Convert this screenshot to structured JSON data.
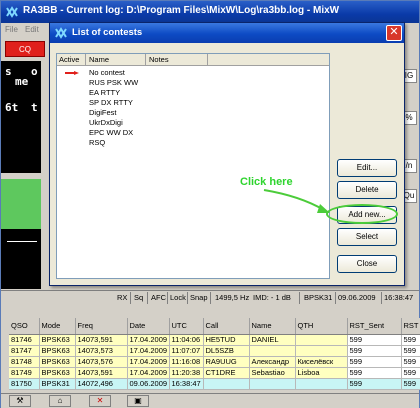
{
  "main_window": {
    "title": "RA3BB - Current log: D:\\Program Files\\MixW\\Log\\ra3bb.log - MixW",
    "menu": [
      "File",
      "Edit"
    ],
    "co_button": "CQ",
    "dark_panel_text": [
      "s",
      "o",
      "me",
      "6t",
      "t"
    ],
    "right_strip": [
      "IG",
      "%",
      "/n",
      "Qu"
    ]
  },
  "status_bar": {
    "rx": "RX",
    "sq": "Sq",
    "afc": "AFC",
    "lock": "Lock",
    "snap": "Snap",
    "freq": "1499,5 Hz",
    "imd": "IMD: - 1 dB",
    "mode": "BPSK31",
    "date": "09.06.2009",
    "time": "16:38:47"
  },
  "qso_table": {
    "headers": [
      "QSO",
      "Mode",
      "Freq",
      "Date",
      "UTC",
      "Call",
      "Name",
      "QTH",
      "RST_Sent",
      "RST"
    ],
    "rows": [
      [
        "81746",
        "BPSK63",
        "14073,591",
        "17.04.2009",
        "11:04:06",
        "HE5TUD",
        "DANIEL",
        "",
        "599",
        "599"
      ],
      [
        "81747",
        "BPSK63",
        "14073,573",
        "17.04.2009",
        "11:07:07",
        "DL5SZB",
        "",
        "",
        "599",
        "599"
      ],
      [
        "81748",
        "BPSK63",
        "14073,576",
        "17.04.2009",
        "11:16:08",
        "RA9UUG",
        "Александр",
        "Киселёвск",
        "599",
        "599"
      ],
      [
        "81749",
        "BPSK63",
        "14073,591",
        "17.04.2009",
        "11:20:38",
        "CT1DRE",
        "Sebastiao",
        "Lisboa",
        "599",
        "599"
      ],
      [
        "81750",
        "BPSK31",
        "14072,496",
        "09.06.2009",
        "16:38:47",
        "",
        "",
        "",
        "599",
        "599"
      ]
    ]
  },
  "dialog": {
    "title": "List of contests",
    "columns": [
      "Active",
      "Name",
      "Notes"
    ],
    "contests": [
      "No contest",
      "RUS PSK WW",
      "EA RTTY",
      "SP DX RTTY",
      "DigiFest",
      "UkrDxDigi",
      "EPC WW DX",
      "RSQ"
    ],
    "buttons": {
      "edit": "Edit...",
      "delete": "Delete",
      "add_new": "Add new...",
      "select": "Select",
      "close": "Close"
    },
    "annotation": "Click here"
  },
  "colors": {
    "annotation": "#2ed42e",
    "title_bar": "#0a3aa8",
    "cq_button": "#e0201c",
    "qso_row": "#ffffc0",
    "qso_selected_row": "#c8f5f5"
  }
}
